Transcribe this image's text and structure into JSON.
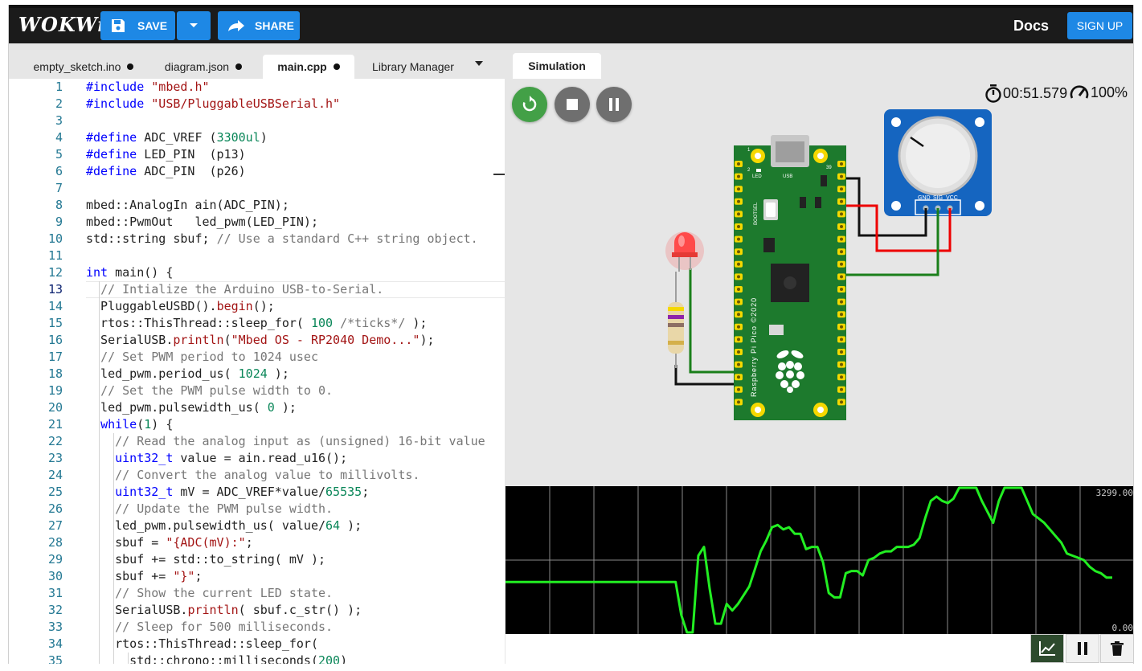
{
  "app": {
    "logo": "WOKWi"
  },
  "toolbar": {
    "save_label": "SAVE",
    "share_label": "SHARE",
    "docs_label": "Docs",
    "signup_label": "SIGN UP"
  },
  "tabs": [
    {
      "label": "empty_sketch.ino",
      "modified": true
    },
    {
      "label": "diagram.json",
      "modified": true
    },
    {
      "label": "main.cpp",
      "modified": true,
      "active": true
    },
    {
      "label": "Library Manager",
      "modified": false
    }
  ],
  "editor": {
    "current_line": 13,
    "lines": [
      "#include \"mbed.h\"",
      "#include \"USB/PluggableUSBSerial.h\"",
      "",
      "#define ADC_VREF (3300ul)",
      "#define LED_PIN  (p13)",
      "#define ADC_PIN  (p26)",
      "",
      "mbed::AnalogIn ain(ADC_PIN);",
      "mbed::PwmOut   led_pwm(LED_PIN);",
      "std::string sbuf; // Use a standard C++ string object.",
      "",
      "int main() {",
      "  // Intialize the Arduino USB-to-Serial.",
      "  PluggableUSBD().begin();",
      "  rtos::ThisThread::sleep_for( 100 /*ticks*/ );",
      "  SerialUSB.println(\"Mbed OS - RP2040 Demo...\");",
      "  // Set PWM period to 1024 usec",
      "  led_pwm.period_us( 1024 );",
      "  // Set the PWM pulse width to 0.",
      "  led_pwm.pulsewidth_us( 0 );",
      "  while(1) {",
      "    // Read the analog input as (unsigned) 16-bit value",
      "    uint32_t value = ain.read_u16();",
      "    // Convert the analog value to millivolts.",
      "    uint32_t mV = ADC_VREF*value/65535;",
      "    // Update the PWM pulse width.",
      "    led_pwm.pulsewidth_us( value/64 );",
      "    sbuf = \"{ADC(mV):\";",
      "    sbuf += std::to_string( mV );",
      "    sbuf += \"}\";",
      "    // Show the current LED state.",
      "    SerialUSB.println( sbuf.c_str() );",
      "    // Sleep for 500 milliseconds.",
      "    rtos::ThisThread::sleep_for(",
      "      std::chrono::milliseconds(200)"
    ]
  },
  "simulation": {
    "tab_label": "Simulation",
    "elapsed": "00:51.579",
    "speed": "100%",
    "board_texts": {
      "led": "LED",
      "usb": "USB",
      "bootsel": "BOOTSEL",
      "name": "Raspberry Pi Pico ©2020",
      "pin1": "1",
      "pin2": "2",
      "pin39": "39"
    },
    "pot_labels": [
      "GND",
      "SIG",
      "VCC"
    ]
  },
  "plotter": {
    "max_label": "3299.00",
    "min_label": "0.00",
    "chart_data": {
      "type": "line",
      "ylim": [
        0,
        3299
      ],
      "series": [
        {
          "color": "#22ee22",
          "values": [
            1150,
            1150,
            1150,
            1150,
            1150,
            1150,
            1150,
            1150,
            1150,
            1150,
            1150,
            1150,
            1150,
            1150,
            1150,
            1150,
            1150,
            1150,
            1150,
            1150,
            1150,
            1150,
            1150,
            1150,
            1150,
            1150,
            1150,
            1150,
            1150,
            1150,
            1150,
            400,
            0,
            0,
            1750,
            1950,
            1000,
            200,
            200,
            650,
            500,
            650,
            850,
            1050,
            1450,
            1850,
            2100,
            2400,
            2450,
            2350,
            2400,
            2250,
            2250,
            1900,
            1950,
            1950,
            1600,
            900,
            800,
            800,
            1350,
            1400,
            1400,
            1300,
            1650,
            1700,
            1800,
            1850,
            1850,
            1950,
            1950,
            1950,
            2000,
            2150,
            2600,
            3000,
            3100,
            3000,
            2950,
            3050,
            3350,
            3350,
            3350,
            3350,
            3000,
            2750,
            2500,
            3000,
            3350,
            3350,
            3350,
            3350,
            3000,
            2700,
            2600,
            2500,
            2350,
            2200,
            2050,
            1800,
            1750,
            1700,
            1650,
            1500,
            1400,
            1350,
            1250,
            1250
          ]
        }
      ]
    }
  },
  "colors": {
    "accent": "#1e88e5",
    "topbar": "#1b1b1b",
    "restart": "#43a047",
    "board": "#1d7a2d",
    "plot_line": "#22ee22"
  }
}
